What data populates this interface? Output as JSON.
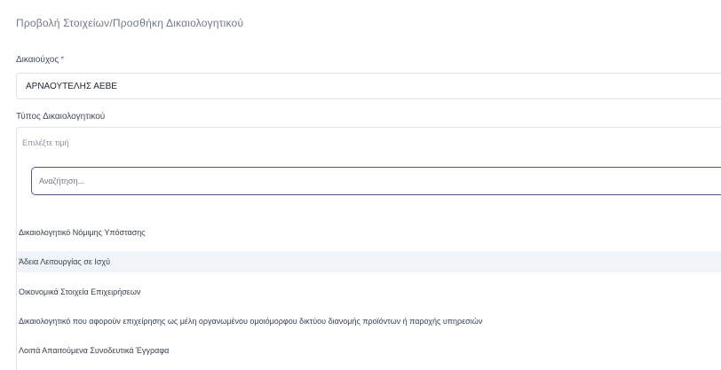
{
  "page": {
    "title": "Προβολή Στοιχείων/Προσθήκη Δικαιολογητικού"
  },
  "form": {
    "beneficiary_label": "Δικαιούχος",
    "required_mark": "*",
    "beneficiary_value": "ΑΡΝΑΟΥΤΕΛΗΣ ΑΕΒΕ",
    "type_label": "Τύπος Δικαιολογητικού",
    "type_placeholder": "Επιλέξτε τιμή",
    "search_placeholder": "Αναζήτηση..."
  },
  "dropdown": {
    "options": [
      "Δικαιολογητικό Νόμιμης Υπόστασης",
      "Άδεια Λειτουργίας σε Ισχύ",
      "Οικονομικά Στοιχεία Επιχειρήσεων",
      "Δικαιολογητικό που αφορούν επιχείρησης ως μέλη οργανωμένου ομοιόμορφου δικτύου διανομής προϊόντων ή παροχής υπηρεσιών",
      "Λοιπά Απαιτούμενα Συνοδευτικά Έγγραφα"
    ],
    "highlighted_index": 1
  }
}
